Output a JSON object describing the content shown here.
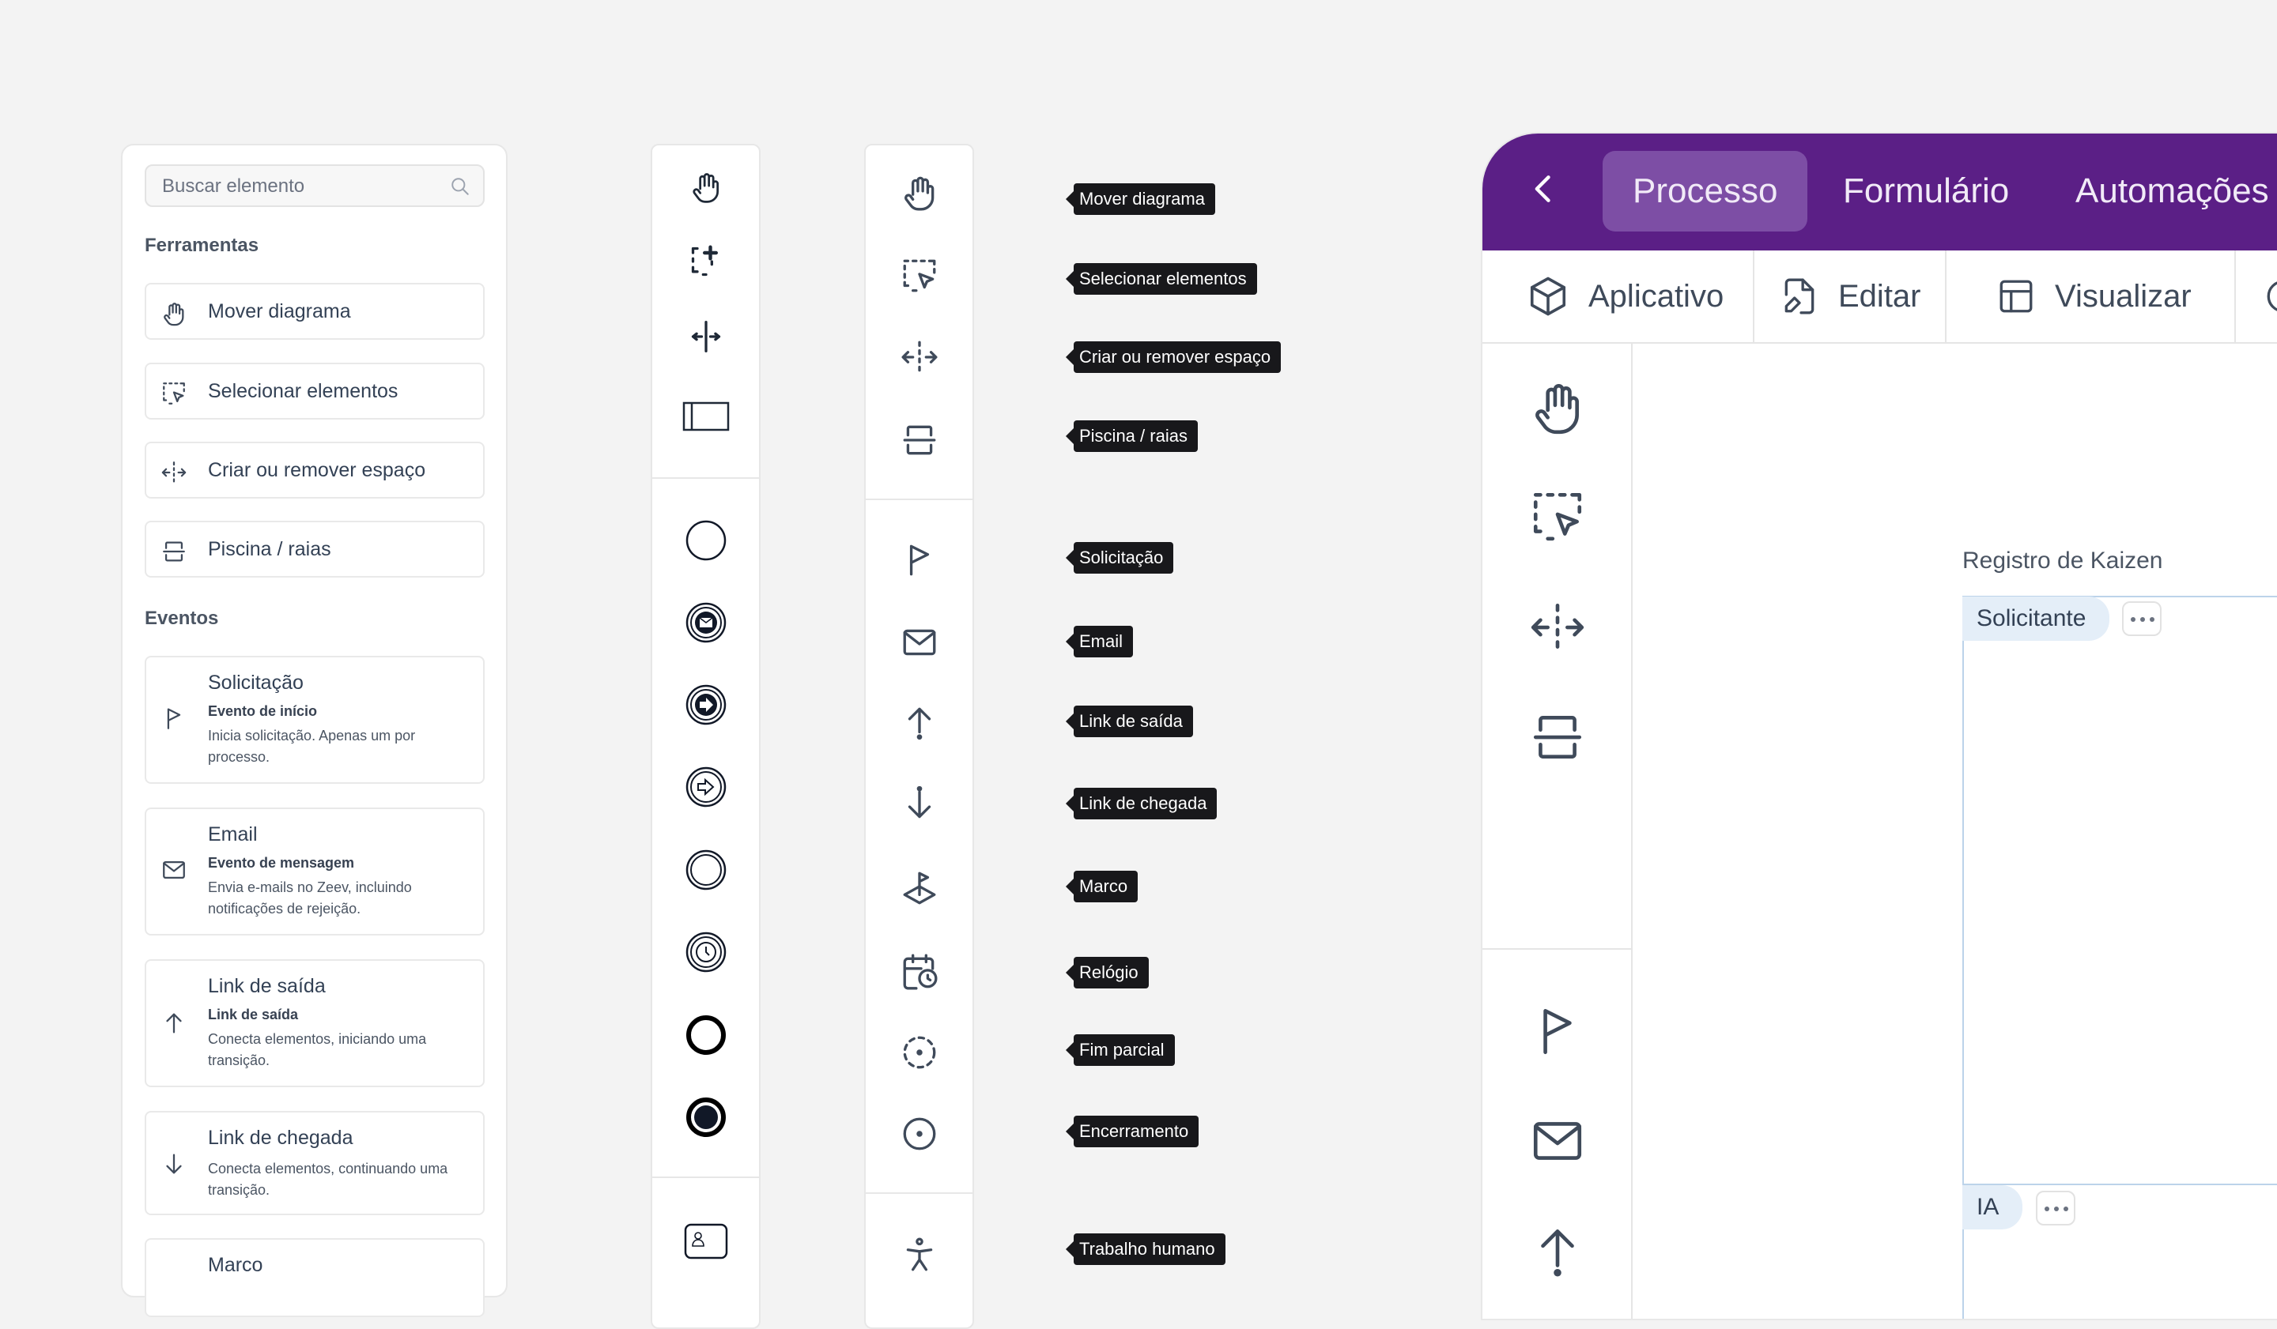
{
  "panel": {
    "search_placeholder": "Buscar elemento",
    "tools_title": "Ferramentas",
    "events_title": "Eventos",
    "tools": [
      "Mover diagrama",
      "Selecionar elementos",
      "Criar ou remover espaço",
      "Piscina / raias"
    ],
    "events": [
      {
        "title": "Solicitação",
        "subtitle": "Evento de início",
        "desc": "Inicia solicitação. Apenas um por processo."
      },
      {
        "title": "Email",
        "subtitle": "Evento de mensagem",
        "desc": "Envia e-mails no Zeev, incluindo notificações de rejeição."
      },
      {
        "title": "Link de saída",
        "subtitle": "Link de saída",
        "desc": "Conecta elementos, iniciando uma transição."
      },
      {
        "title": "Link de chegada",
        "subtitle": "",
        "desc": "Conecta elementos, continuando uma transição."
      },
      {
        "title": "Marco",
        "subtitle": "",
        "desc": ""
      }
    ]
  },
  "tooltips": [
    "Mover diagrama",
    "Selecionar elementos",
    "Criar ou remover espaço",
    "Piscina / raias",
    "Solicitação",
    "Email",
    "Link de saída",
    "Link de chegada",
    "Marco",
    "Relógio",
    "Fim parcial",
    "Encerramento",
    "Trabalho humano"
  ],
  "app": {
    "tabs": [
      "Processo",
      "Formulário",
      "Automações"
    ],
    "toolbar": [
      "Aplicativo",
      "Editar",
      "Visualizar"
    ],
    "canvas_title": "Registro de Kaizen",
    "lanes": [
      "Solicitante",
      "IA"
    ]
  },
  "colors": {
    "header": "#5b1f86",
    "active_tab": "#7d4ea5",
    "lane": "#e4eef8",
    "tooltip": "#18181b"
  }
}
